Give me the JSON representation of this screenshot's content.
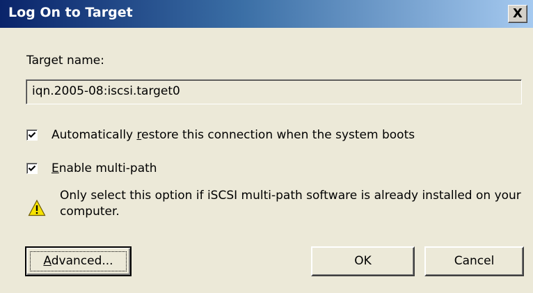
{
  "window": {
    "title": "Log On to Target",
    "close_glyph": "X"
  },
  "target": {
    "label": "Target name:",
    "value": "iqn.2005-08:iscsi.target0"
  },
  "options": {
    "auto_restore": {
      "checked": true,
      "label_prefix": "Automatically ",
      "label_mnemonic": "r",
      "label_suffix": "estore this connection when the system boots"
    },
    "multipath": {
      "checked": true,
      "label_mnemonic": "E",
      "label_suffix": "nable multi-path"
    }
  },
  "warning": {
    "icon": "warning-triangle-icon",
    "text": "Only select this option if iSCSI multi-path software is already installed on your computer."
  },
  "buttons": {
    "advanced_mnemonic": "A",
    "advanced_suffix": "dvanced...",
    "ok": "OK",
    "cancel": "Cancel"
  }
}
